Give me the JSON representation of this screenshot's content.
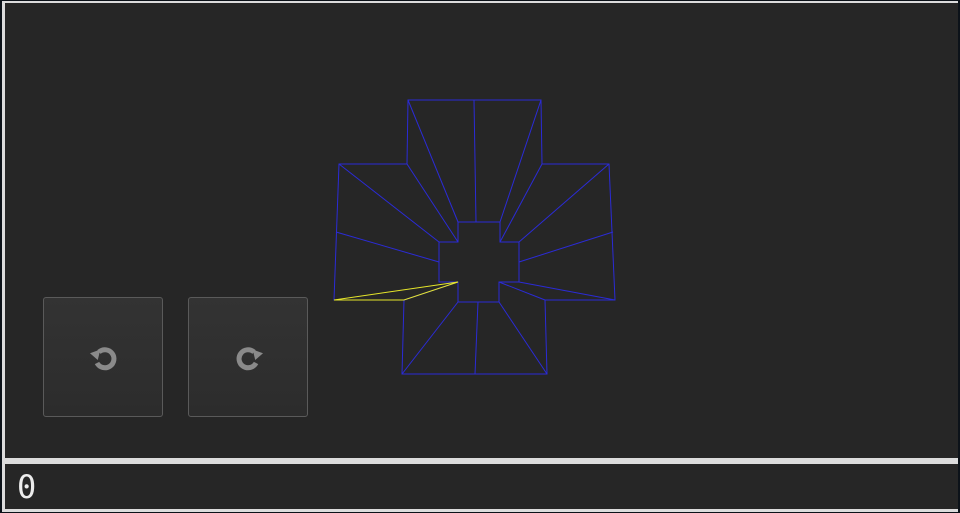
{
  "score": {
    "value": "0"
  },
  "colors": {
    "background": "#262626",
    "frame": "#dcdcdc",
    "polygon_outline": "#2b2bd6",
    "highlight_outline": "#e6e62a",
    "button_icon": "#8a8a8a"
  },
  "controls": {
    "rotate_left": {
      "icon": "rotate-counterclockwise-icon"
    },
    "rotate_right": {
      "icon": "rotate-clockwise-icon"
    }
  },
  "board": {
    "shape": "plus/cross tunnel",
    "segments": 16,
    "selected_segment_index": 8
  }
}
